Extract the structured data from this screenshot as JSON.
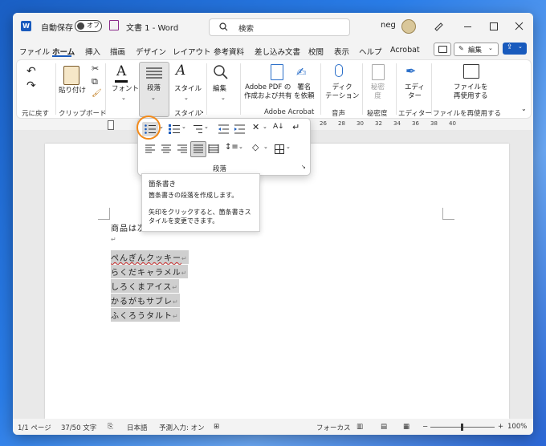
{
  "titlebar": {
    "autosave_label": "自動保存",
    "autosave_state": "オフ",
    "doc_title": "文書 1  -  Word",
    "search_placeholder": "検索",
    "user": "neg"
  },
  "tabs": [
    "ファイル",
    "ホーム",
    "挿入",
    "描画",
    "デザイン",
    "レイアウト",
    "参考資料",
    "差し込み文書",
    "校閲",
    "表示",
    "ヘルプ",
    "Acrobat"
  ],
  "active_tab": "ホーム",
  "header_buttons": {
    "edit_mode": "編集",
    "comments_icon": "comment-icon",
    "share_icon": "share-icon"
  },
  "ribbon": {
    "undo_group": "元に戻す",
    "paste": "貼り付け",
    "clipboard_group": "クリップボード",
    "font": "フォント",
    "paragraph": "段落",
    "styles": "スタイル",
    "styles_group": "スタイル",
    "editing": "編集",
    "acrobat1": "Adobe PDF の\n作成および共有",
    "acrobat2": "署名\nを依頼",
    "acrobat_group": "Adobe Acrobat",
    "dictate": "ディク\nテーション",
    "voice_group": "音声",
    "sensitivity": "秘密\n度",
    "sensitivity_group": "秘密度",
    "editor": "エディ\nター",
    "editor_group": "エディター",
    "reuse": "ファイルを\n再使用する",
    "reuse_group": "ファイルを再使用する"
  },
  "ruler_numbers": [
    "26",
    "28",
    "30",
    "32",
    "34",
    "36",
    "38",
    "40"
  ],
  "paragraph_popup": {
    "title": "段落"
  },
  "tooltip": {
    "title": "箇条書き",
    "desc": "箇条書きの段落を作成します。",
    "hint": "矢印をクリックすると、箇条書きスタイルを変更できます。"
  },
  "document": {
    "intro": "商品は次",
    "items": [
      "ぺんぎんクッキー",
      "らくだキャラメル",
      "しろくまアイス",
      "かるがもサブレ",
      "ふくろうタルト"
    ]
  },
  "status": {
    "page": "1/1 ページ",
    "words": "37/50 文字",
    "language": "日本語",
    "predict": "予測入力: オン",
    "focus": "フォーカス",
    "zoom": "100%"
  },
  "colors": {
    "accent": "#185abd",
    "highlight": "#f28a1a",
    "selection": "#cfcfcf"
  }
}
